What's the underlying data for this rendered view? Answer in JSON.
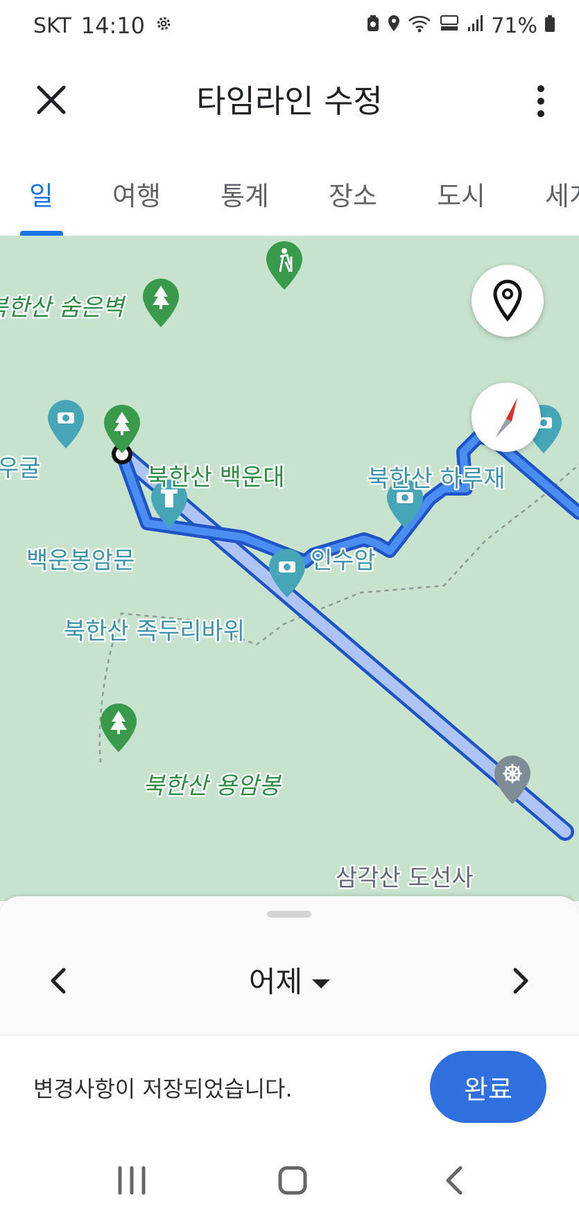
{
  "status_bar": {
    "carrier": "SKT",
    "time": "14:10",
    "battery": "71%"
  },
  "app_bar": {
    "title": "타임라인 수정"
  },
  "tabs": [
    {
      "label": "일",
      "active": true
    },
    {
      "label": "여행",
      "active": false
    },
    {
      "label": "통계",
      "active": false
    },
    {
      "label": "장소",
      "active": false
    },
    {
      "label": "도시",
      "active": false
    },
    {
      "label": "세계",
      "active": false
    }
  ],
  "map": {
    "places": {
      "p1": "북한산 숨은벽",
      "p2": "우굴",
      "p3": "북한산 백운대",
      "p4": "북한산 하루재",
      "p5": "백운봉암문",
      "p6": "인수암",
      "p7": "북한산 족두리바위",
      "p8": "북한산 용암봉",
      "p9": "삼각산 도선사"
    },
    "colors": {
      "route": "#4285f4",
      "route_border": "#1f54c6",
      "park_pin": "#3a9a4c",
      "poi_pin": "#46a6b8",
      "land": "#c7e3ce"
    }
  },
  "sheet": {
    "date_label": "어제"
  },
  "snackbar": {
    "message": "변경사항이 저장되었습니다.",
    "action": "완료"
  },
  "colors": {
    "accent": "#1a73e8",
    "done_button": "#2f6fde"
  }
}
